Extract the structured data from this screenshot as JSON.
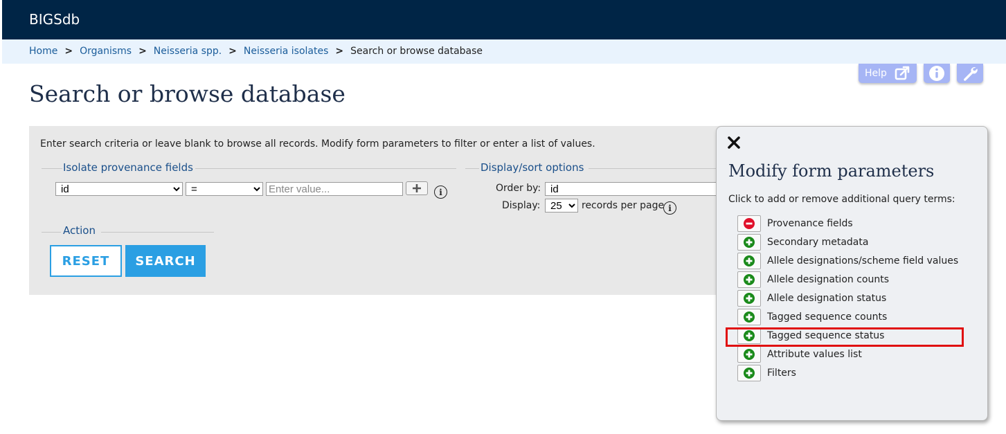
{
  "header": {
    "app_title": "BIGSdb"
  },
  "breadcrumbs": {
    "links": [
      "Home",
      "Organisms",
      "Neisseria spp.",
      "Neisseria isolates"
    ],
    "separator": ">",
    "current": "Search or browse database"
  },
  "toolbar": {
    "help_label": "Help",
    "icons": [
      "external-link-icon",
      "info-icon",
      "wrench-icon"
    ]
  },
  "page": {
    "title": "Search or browse database"
  },
  "search_form": {
    "instructions": "Enter search criteria or leave blank to browse all records. Modify form parameters to filter or enter a list of values.",
    "provenance": {
      "legend": "Isolate provenance fields",
      "field_value": "id",
      "operator_value": "=",
      "value_placeholder": "Enter value..."
    },
    "display": {
      "legend": "Display/sort options",
      "order_by_label": "Order by:",
      "order_by_value": "id",
      "display_label": "Display:",
      "display_value": "25",
      "records_suffix": "records per page"
    },
    "action": {
      "legend": "Action",
      "reset_label": "RESET",
      "search_label": "SEARCH"
    }
  },
  "modify_panel": {
    "title": "Modify form parameters",
    "description": "Click to add or remove additional query terms:",
    "options": [
      {
        "label": "Provenance fields",
        "state": "remove"
      },
      {
        "label": "Secondary metadata",
        "state": "add"
      },
      {
        "label": "Allele designations/scheme field values",
        "state": "add"
      },
      {
        "label": "Allele designation counts",
        "state": "add"
      },
      {
        "label": "Allele designation status",
        "state": "add"
      },
      {
        "label": "Tagged sequence counts",
        "state": "add"
      },
      {
        "label": "Tagged sequence status",
        "state": "add"
      },
      {
        "label": "Attribute values list",
        "state": "add"
      },
      {
        "label": "Filters",
        "state": "add"
      }
    ],
    "highlighted_option": "Tagged sequence status"
  },
  "colors": {
    "header_bg": "#002546",
    "breadcrumb_bg": "#e9f3fd",
    "link": "#1a5c9a",
    "accent_button": "#2b9fe3",
    "toolbar_button": "#a6b5f5",
    "add_icon": "#1a8a1a",
    "remove_icon": "#e0102a",
    "highlight": "#e01010"
  }
}
